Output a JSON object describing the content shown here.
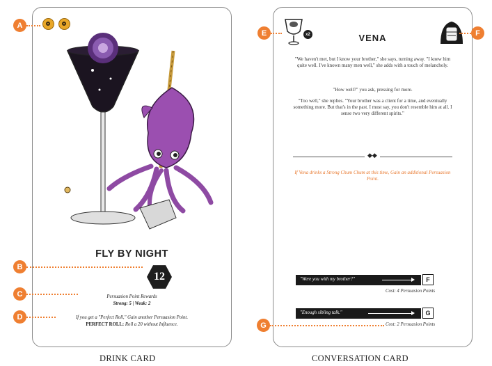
{
  "drink_card": {
    "title": "FLY BY NIGHT",
    "value": "12",
    "rewards_heading": "Persuasion Point Rewards",
    "strong_weak": "Strong: 5 | Weak: 2",
    "bonus_line": "If you get a \"Perfect Roll,\" Gain another Persuasion Point.",
    "perfect_roll_label": "PERFECT ROLL:",
    "perfect_roll_text": "Roll a 20 without Influence.",
    "caption": "DRINK CARD"
  },
  "conversation_card": {
    "title": "VENA",
    "badge": "x2",
    "paragraphs": [
      "\"We haven't met, but I know your brother,\" she says, turning away. \"I knew him quite well. I've known many men well,\" she adds with a touch of melancholy.",
      "\"How well?\" you ask, pressing for more.",
      "\"Too well,\" she replies. \"Your brother was a client for a time, and eventually something more. But that's in the past. I must say, you don't resemble him at all. I sense two very different spirits.\""
    ],
    "separator_mark": "◆◆",
    "note": "If Vena drinks a Strong Chum Chum at this time, Gain an additional Persuasion Point.",
    "choices": [
      {
        "text": "\"Were you with my brother?\"",
        "letter": "F",
        "cost": "Cost: 4 Persuasion Points"
      },
      {
        "text": "\"Enough sibling talk.\"",
        "letter": "G",
        "cost": "Cost: 2 Persuasion Points"
      }
    ],
    "caption": "CONVERSATION CARD"
  },
  "markers": [
    "A",
    "B",
    "C",
    "D",
    "E",
    "F",
    "G"
  ],
  "colors": {
    "accent": "#ef7f31",
    "hex_bg": "#1e1e1e",
    "squid": "#9b4fb0",
    "coin": "#e9a728"
  },
  "icons": [
    "coin-icon",
    "cocktail-glass-illustration",
    "squid-illustration",
    "wine-glass-portrait-icon",
    "character-portrait-icon"
  ]
}
